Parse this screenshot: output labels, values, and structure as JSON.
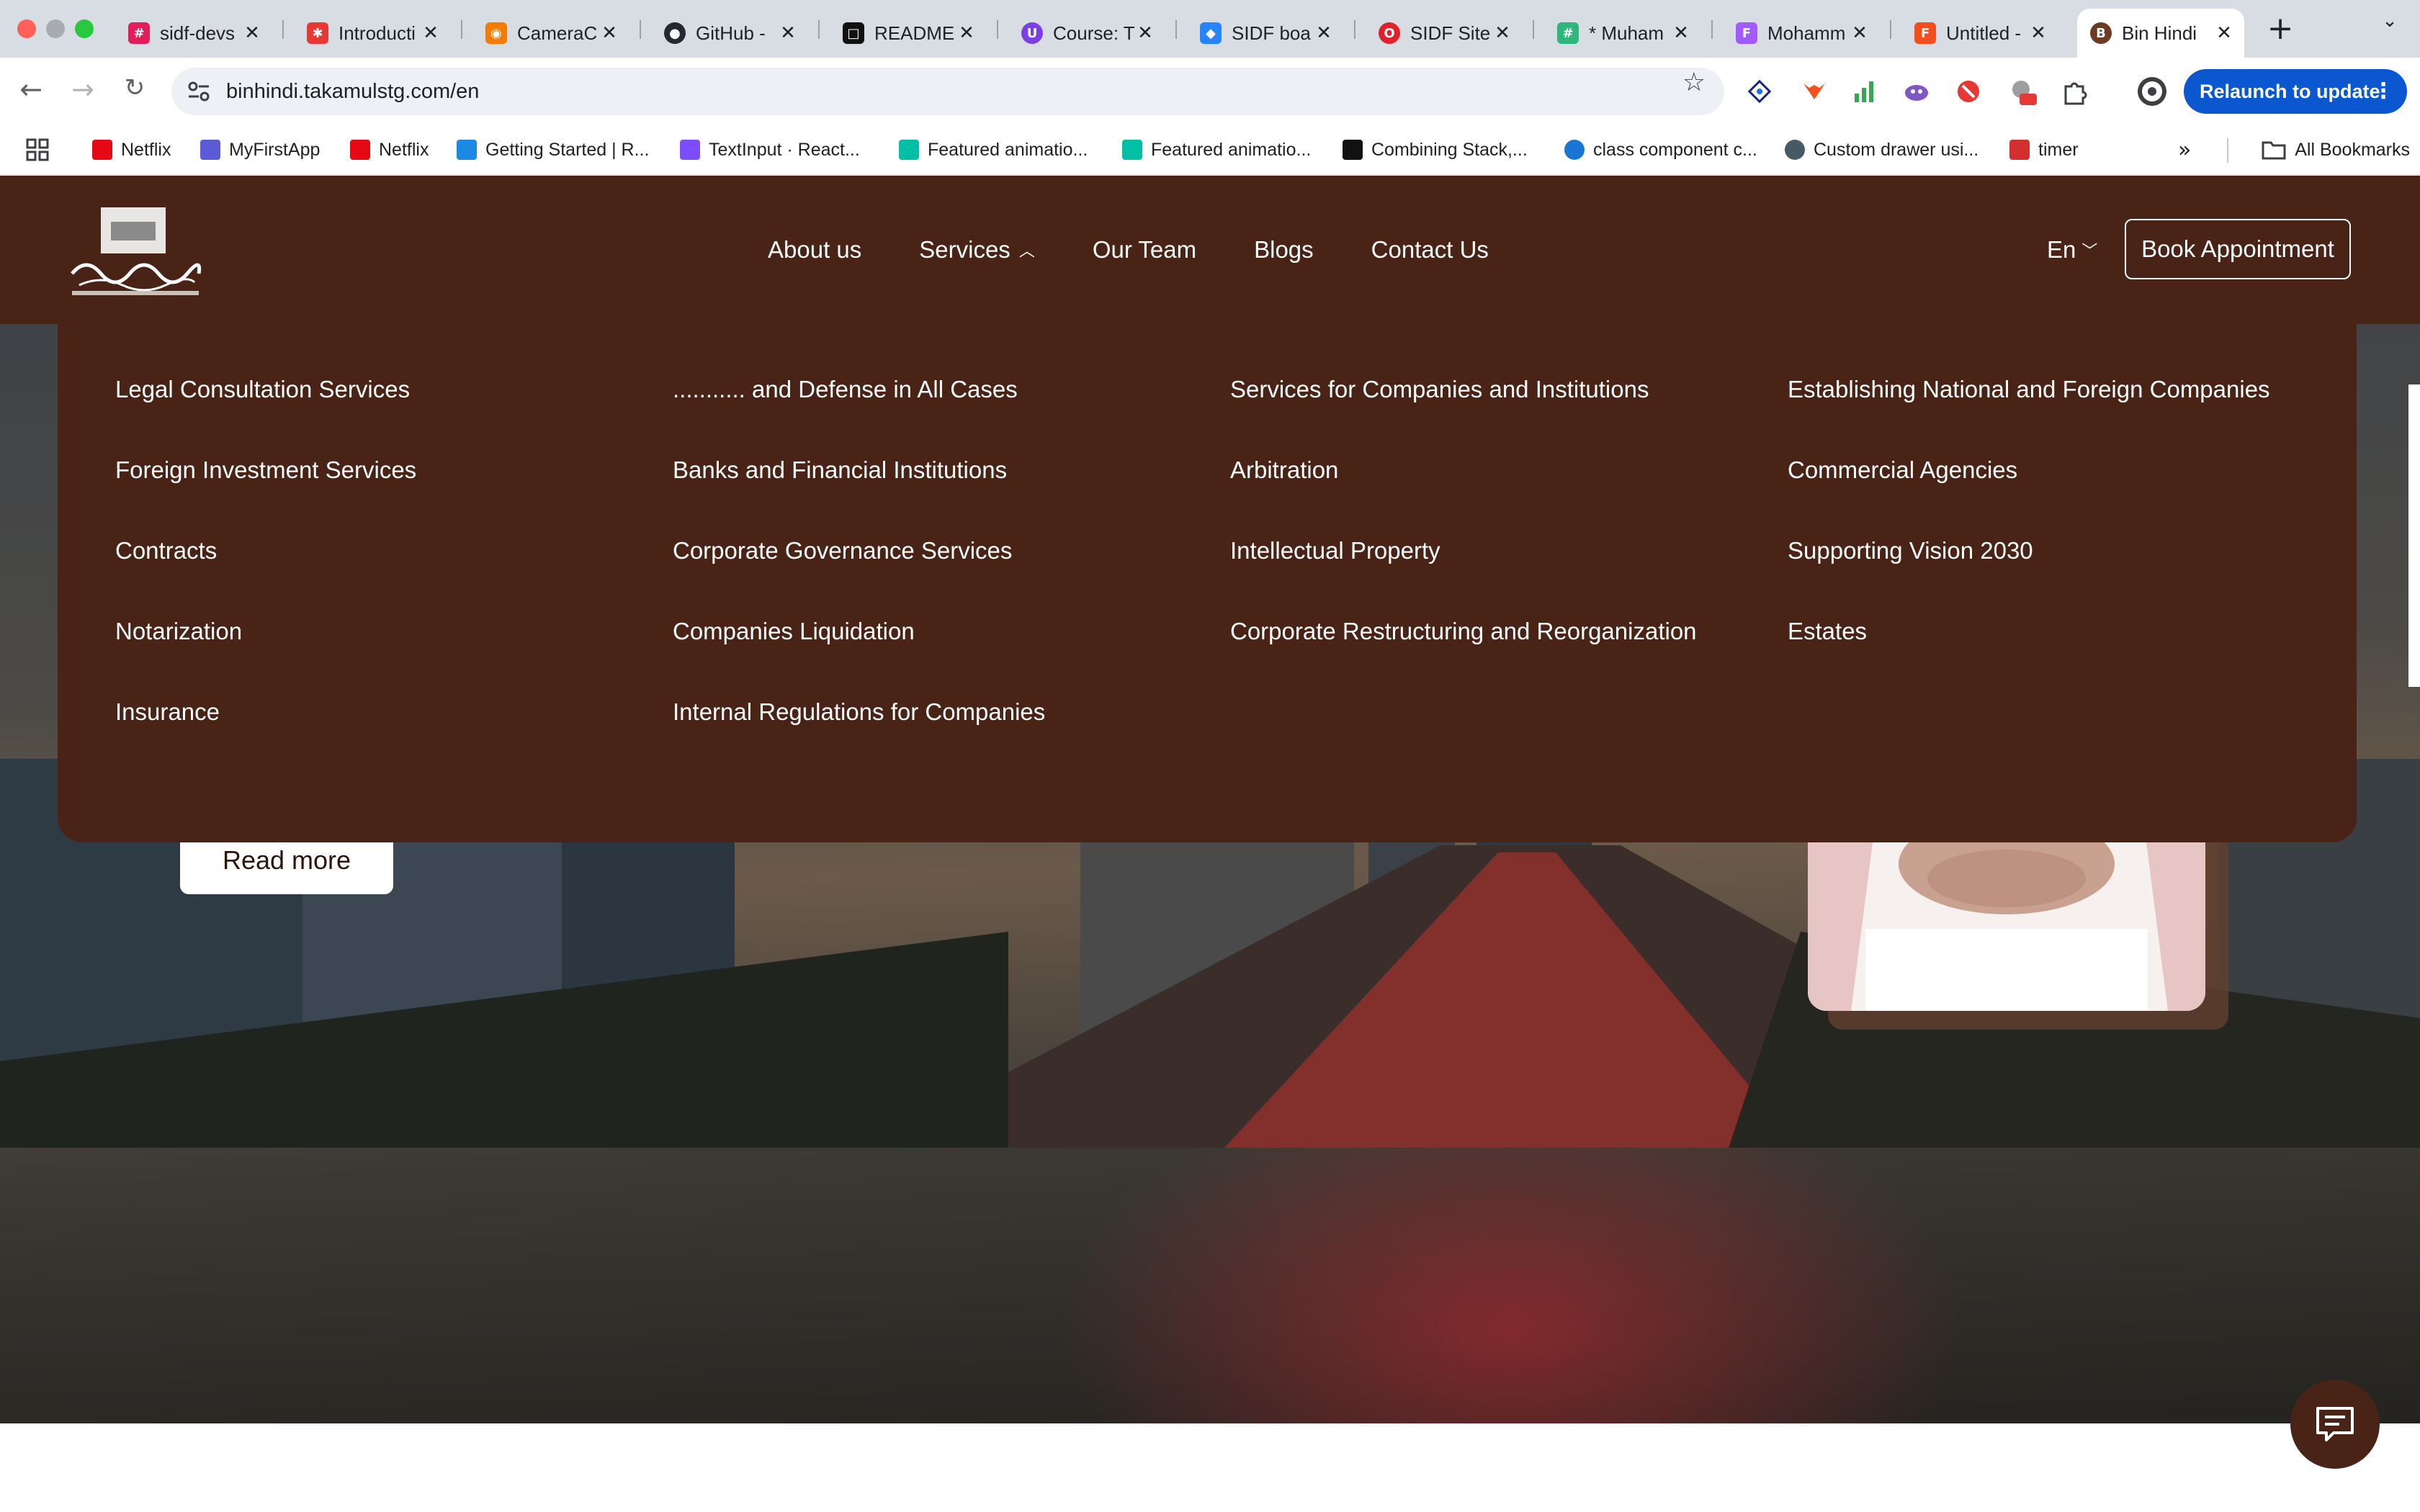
{
  "browser": {
    "tabs": [
      {
        "title": "sidf-devs",
        "icon": "slack-icon",
        "color": "#e01e5a"
      },
      {
        "title": "Introducti",
        "icon": "redbox-icon",
        "color": "#e53935"
      },
      {
        "title": "CameraC",
        "icon": "camera-app-icon",
        "color": "#f57c00"
      },
      {
        "title": "GitHub -",
        "icon": "github-icon",
        "color": "#24292f"
      },
      {
        "title": "README",
        "icon": "readme-icon",
        "color": "#111111"
      },
      {
        "title": "Course: T",
        "icon": "course-icon",
        "color": "#7b3fe4"
      },
      {
        "title": "SIDF boa",
        "icon": "jira-icon",
        "color": "#2684ff"
      },
      {
        "title": "SIDF Site",
        "icon": "opera-icon",
        "color": "#e0202a"
      },
      {
        "title": "* Muham",
        "icon": "slack-icon",
        "color": "#2eb67d"
      },
      {
        "title": "Mohamm",
        "icon": "figma-icon",
        "color": "#a259ff"
      },
      {
        "title": "Untitled -",
        "icon": "figma-icon",
        "color": "#f24e1e"
      },
      {
        "title": "Bin Hindi",
        "icon": "binhindi-icon",
        "color": "#6d3b24"
      }
    ],
    "url": "binhindi.takamulstg.com/en",
    "relaunch_label": "Relaunch to update",
    "bookmarks": [
      {
        "label": "Netflix",
        "color": "#e50914"
      },
      {
        "label": "MyFirstApp",
        "color": "#5b5bd6"
      },
      {
        "label": "Netflix",
        "color": "#e50914"
      },
      {
        "label": "Getting Started | R...",
        "color": "#1e88e5"
      },
      {
        "label": "TextInput · React...",
        "color": "#7c4dff"
      },
      {
        "label": "Featured animatio...",
        "color": "#00bfa5"
      },
      {
        "label": "Featured animatio...",
        "color": "#00bfa5"
      },
      {
        "label": "Combining Stack,...",
        "color": "#111111"
      },
      {
        "label": "class component c...",
        "color": "#1976d2"
      },
      {
        "label": "Custom drawer usi...",
        "color": "#455a64"
      },
      {
        "label": "timer",
        "color": "#d32f2f"
      }
    ],
    "all_bookmarks": "All Bookmarks"
  },
  "site": {
    "nav": {
      "about": "About us",
      "services": "Services",
      "team": "Our Team",
      "blogs": "Blogs",
      "contact": "Contact Us"
    },
    "language": "En",
    "book_button": "Book Appointment",
    "brand_color": "#482316",
    "services_menu": [
      [
        "Legal Consultation Services",
        "Foreign Investment Services",
        "Contracts",
        "Notarization",
        "Insurance"
      ],
      [
        "........... and Defense in All Cases",
        "Banks and Financial Institutions",
        "Corporate Governance Services",
        "Companies Liquidation",
        "Internal Regulations for Companies"
      ],
      [
        "Services for Companies and Institutions",
        "Arbitration",
        "Intellectual Property",
        "Corporate Restructuring and Reorganization"
      ],
      [
        "Establishing National and Foreign Companies",
        "Commercial Agencies",
        "Supporting Vision 2030",
        "Estates"
      ]
    ],
    "read_more": "Read more"
  }
}
